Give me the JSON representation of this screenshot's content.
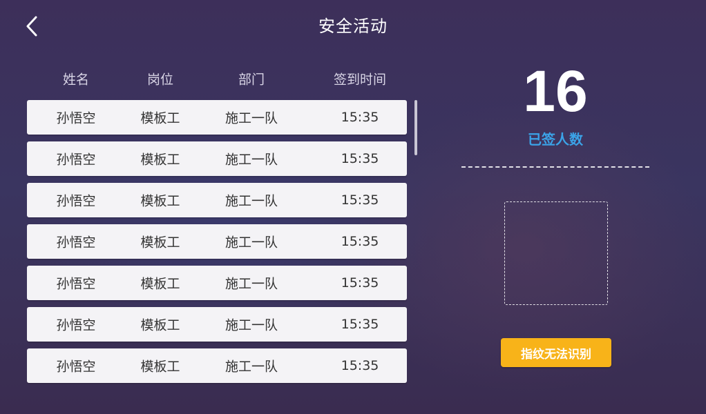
{
  "header": {
    "title": "安全活动",
    "back_icon": "chevron-left-icon"
  },
  "table": {
    "columns": [
      "姓名",
      "岗位",
      "部门",
      "签到时间"
    ],
    "rows": [
      {
        "name": "孙悟空",
        "position": "模板工",
        "department": "施工一队",
        "time": "15:35"
      },
      {
        "name": "孙悟空",
        "position": "模板工",
        "department": "施工一队",
        "time": "15:35"
      },
      {
        "name": "孙悟空",
        "position": "模板工",
        "department": "施工一队",
        "time": "15:35"
      },
      {
        "name": "孙悟空",
        "position": "模板工",
        "department": "施工一队",
        "time": "15:35"
      },
      {
        "name": "孙悟空",
        "position": "模板工",
        "department": "施工一队",
        "time": "15:35"
      },
      {
        "name": "孙悟空",
        "position": "模板工",
        "department": "施工一队",
        "time": "15:35"
      },
      {
        "name": "孙悟空",
        "position": "模板工",
        "department": "施工一队",
        "time": "15:35"
      }
    ]
  },
  "stats": {
    "signed_count": "16",
    "signed_label": "已签人数",
    "label_color": "#3ba3e8"
  },
  "fingerprint": {
    "button_label": "指纹无法识别",
    "button_color": "#f8b319"
  }
}
